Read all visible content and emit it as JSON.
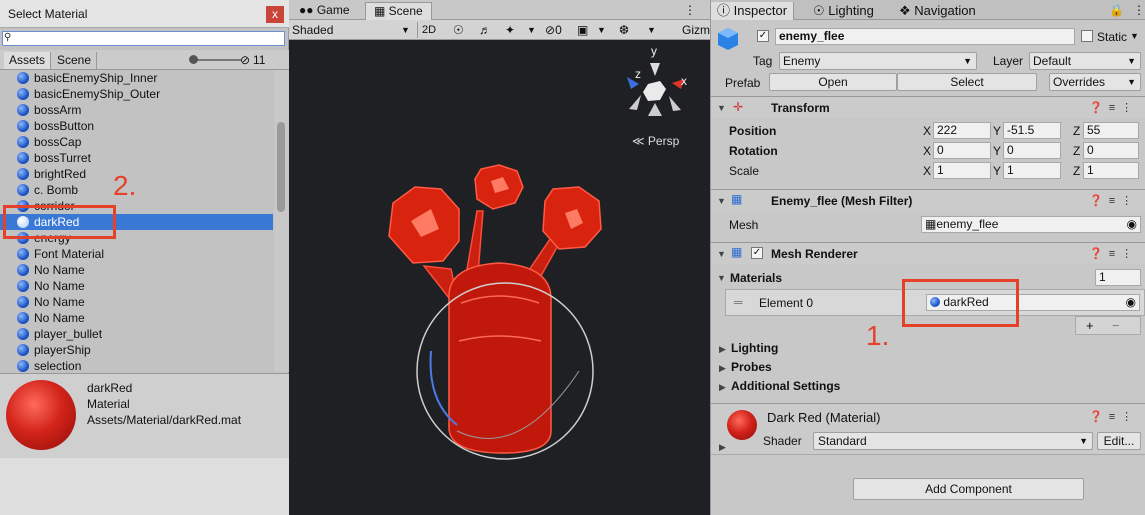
{
  "select_material": {
    "title": "Select Material",
    "close": "x",
    "search_value": "",
    "tabs": [
      "Assets",
      "Scene"
    ],
    "hidden_count": "11",
    "items": [
      "basicEnemyShip_Inner",
      "basicEnemyShip_Outer",
      "bossArm",
      "bossButton",
      "bossCap",
      "bossTurret",
      "brightRed",
      "c. Bomb",
      "corridor",
      "darkRed",
      "energy",
      "Font Material",
      "No Name",
      "No Name",
      "No Name",
      "No Name",
      "player_bullet",
      "playerShip",
      "selection"
    ],
    "selected_index": 9,
    "preview": {
      "name": "darkRed",
      "type": "Material",
      "path": "Assets/Material/darkRed.mat"
    }
  },
  "annotations": {
    "one": "1.",
    "two": "2."
  },
  "scene": {
    "tabs": [
      "Game",
      "Scene"
    ],
    "shading": "Shaded",
    "mode_2d": "2D",
    "hidden_fx": "0",
    "gizmos": "Gizm",
    "persp": "Persp",
    "axes": {
      "x": "x",
      "y": "y",
      "z": "z"
    }
  },
  "inspector": {
    "tabs": [
      "Inspector",
      "Lighting",
      "Navigation"
    ],
    "object_name": "enemy_flee",
    "static_label": "Static",
    "tag_label": "Tag",
    "tag_value": "Enemy",
    "layer_label": "Layer",
    "layer_value": "Default",
    "prefab_label": "Prefab",
    "open": "Open",
    "select": "Select",
    "overrides": "Overrides",
    "transform": {
      "title": "Transform",
      "position_label": "Position",
      "rotation_label": "Rotation",
      "scale_label": "Scale",
      "position": {
        "x": "222",
        "y": "-51.5",
        "z": "55"
      },
      "rotation": {
        "x": "0",
        "y": "0",
        "z": "0"
      },
      "scale": {
        "x": "1",
        "y": "1",
        "z": "1"
      }
    },
    "mesh_filter": {
      "title": "Enemy_flee (Mesh Filter)",
      "mesh_label": "Mesh",
      "mesh_value": "enemy_flee"
    },
    "mesh_renderer": {
      "title": "Mesh Renderer",
      "materials_label": "Materials",
      "materials_count": "1",
      "element_label": "Element 0",
      "element_value": "darkRed",
      "plus": "+",
      "minus": "−",
      "lighting": "Lighting",
      "probes": "Probes",
      "additional": "Additional Settings"
    },
    "material": {
      "title": "Dark Red (Material)",
      "shader_label": "Shader",
      "shader_value": "Standard",
      "edit": "Edit..."
    },
    "add_component": "Add Component"
  }
}
